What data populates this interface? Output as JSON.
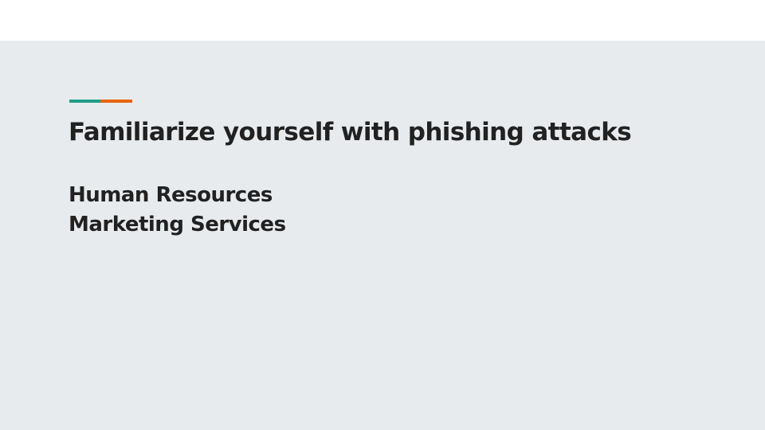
{
  "colors": {
    "background": "#e8ebed",
    "top_band": "#ffffff",
    "text": "#212121",
    "accent_teal": "#1f9e89",
    "accent_orange": "#e8630a"
  },
  "slide": {
    "title": "Familiarize yourself with phishing attacks",
    "subtitle_lines": [
      "Human Resources",
      "Marketing Services"
    ]
  }
}
